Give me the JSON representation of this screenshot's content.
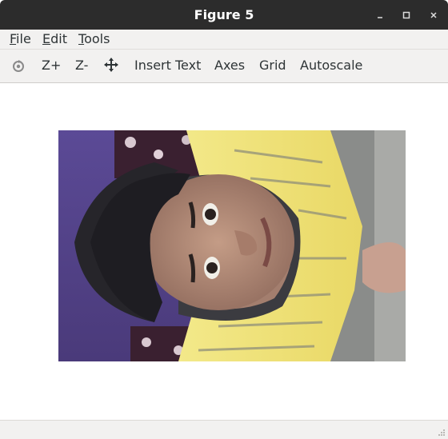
{
  "window": {
    "title": "Figure 5",
    "minimize_glyph": "–",
    "maximize_glyph": "□",
    "close_glyph": "×"
  },
  "menu": {
    "file": {
      "mnemonic": "F",
      "rest": "ile"
    },
    "edit": {
      "mnemonic": "E",
      "rest": "dit"
    },
    "tools": {
      "mnemonic": "T",
      "rest": "ools"
    }
  },
  "toolbar": {
    "reset_icon": "refresh-icon",
    "zoom_in": "Z+",
    "zoom_out": "Z-",
    "pan_icon": "move-arrows-icon",
    "insert_text": "Insert Text",
    "axes": "Axes",
    "grid": "Grid",
    "autoscale": "Autoscale"
  },
  "figure": {
    "content": "photo-image",
    "colors": {
      "shirt": "#efe06a",
      "skin": "#b8907a",
      "hair": "#2a2a2e",
      "background": "#5a4a8a"
    }
  }
}
